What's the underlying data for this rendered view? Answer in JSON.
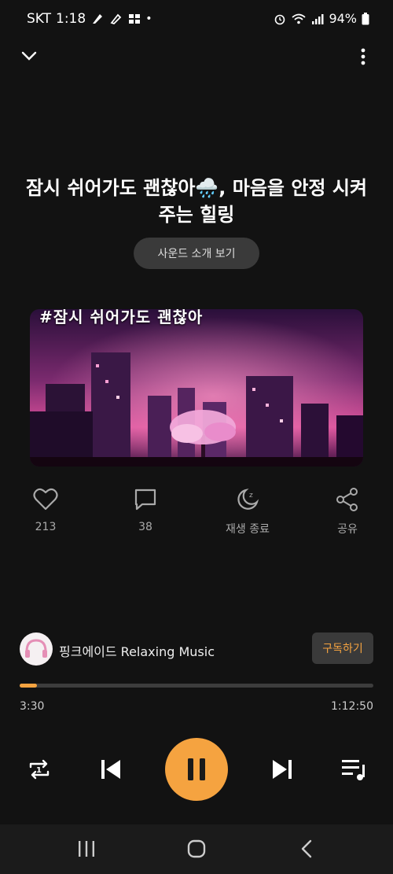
{
  "status": {
    "carrier": "SKT",
    "time": "1:18",
    "battery": "94%"
  },
  "track": {
    "title": "잠시 쉬어가도 괜찮아🌧️, 마음을 안정 시켜주는 힐링",
    "intro_button": "사운드 소개 보기",
    "art_caption": "#잠시 쉬어가도 괜찮아"
  },
  "actions": {
    "likes": "213",
    "comments": "38",
    "sleep_timer": "재생 종료",
    "share": "공유"
  },
  "channel": {
    "name": "핑크에이드 Relaxing Music",
    "subscribe": "구독하기"
  },
  "player": {
    "elapsed": "3:30",
    "duration": "1:12:50",
    "progress": 0.048
  },
  "colors": {
    "accent": "#f5a340",
    "background": "#121212"
  }
}
